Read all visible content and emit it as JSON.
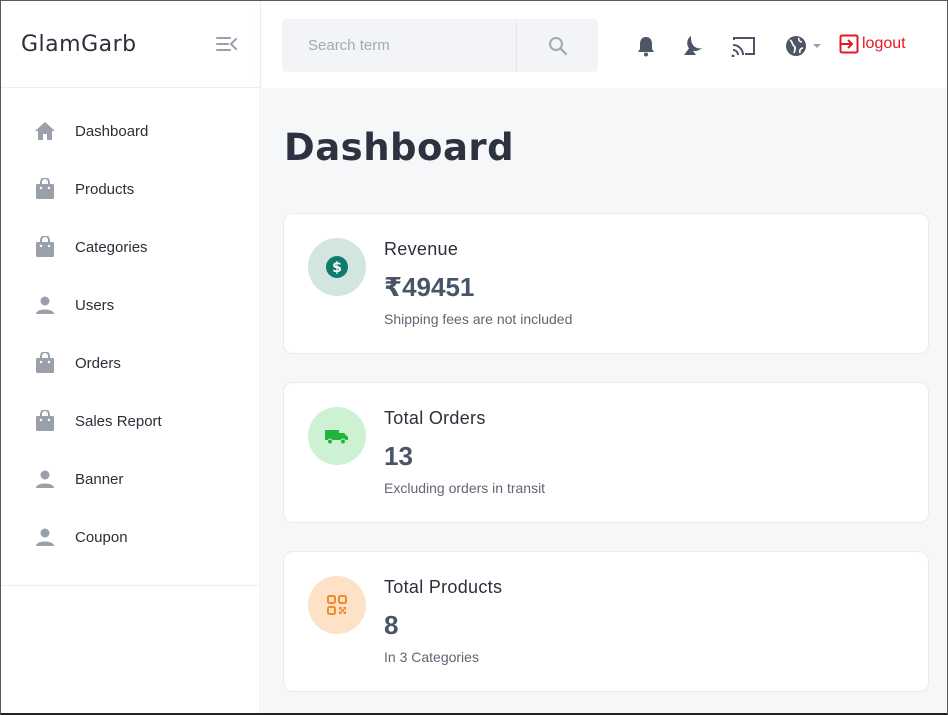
{
  "brand": "GlamGarb",
  "sidebar": {
    "items": [
      {
        "label": "Dashboard",
        "icon": "home-icon"
      },
      {
        "label": "Products",
        "icon": "bag-icon"
      },
      {
        "label": "Categories",
        "icon": "bag-icon"
      },
      {
        "label": "Users",
        "icon": "user-icon"
      },
      {
        "label": "Orders",
        "icon": "bag-icon"
      },
      {
        "label": "Sales Report",
        "icon": "bag-icon"
      },
      {
        "label": "Banner",
        "icon": "user-icon"
      },
      {
        "label": "Coupon",
        "icon": "user-icon"
      }
    ]
  },
  "topbar": {
    "search_placeholder": "Search term",
    "icons": [
      "bell-icon",
      "moon-icon",
      "cast-icon",
      "globe-icon"
    ],
    "logout_label": "logout"
  },
  "page": {
    "title": "Dashboard"
  },
  "cards": [
    {
      "title": "Revenue",
      "value": "₹49451",
      "note": "Shipping fees are not included",
      "icon": "dollar-icon",
      "bg": "#d2e5e1",
      "fg": "#0e7c6b"
    },
    {
      "title": "Total Orders",
      "value": "13",
      "note": "Excluding orders in transit",
      "icon": "truck-icon",
      "bg": "#ccf2d3",
      "fg": "#22b33a"
    },
    {
      "title": "Total Products",
      "value": "8",
      "note": "In 3 Categories",
      "icon": "qr-icon",
      "bg": "#fde2c7",
      "fg": "#f28a2a"
    }
  ],
  "colors": {
    "accent_red": "#e01b22",
    "icon_gray": "#9aa0aa"
  }
}
